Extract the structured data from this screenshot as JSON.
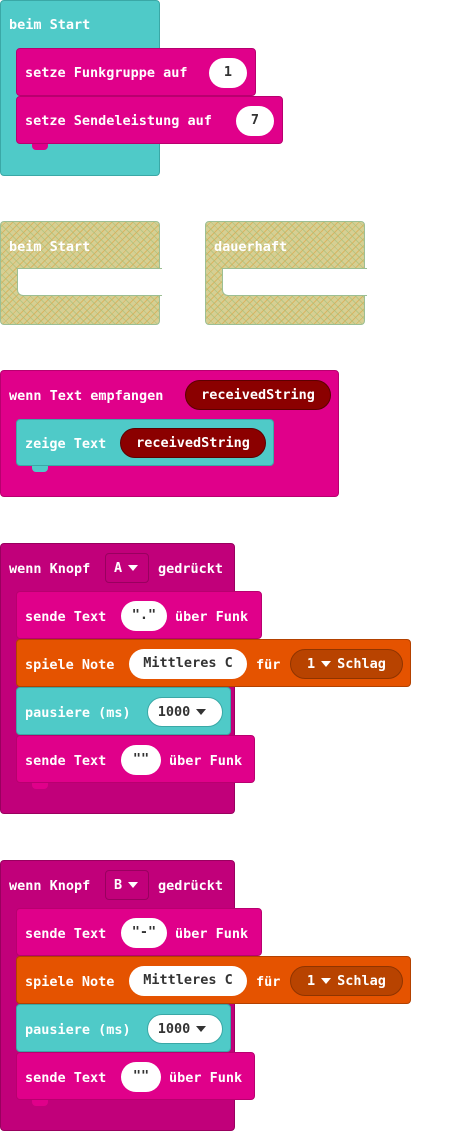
{
  "colors": {
    "basic": "#4fcac8",
    "radio": "#e0008a",
    "input": "#c1007a",
    "music": "#e55300",
    "text_var": "#8b0000"
  },
  "group1": {
    "hat": "beim Start",
    "set_group_label": "setze Funkgruppe auf",
    "set_group_value": "1",
    "set_power_label": "setze Sendeleistung auf",
    "set_power_value": "7"
  },
  "disabled": {
    "start_label": "beim Start",
    "forever_label": "dauerhaft"
  },
  "group2": {
    "hat_label": "wenn Text empfangen",
    "hat_var": "receivedString",
    "show_label": "zeige Text",
    "show_var": "receivedString"
  },
  "group3": {
    "hat_pre": "wenn Knopf",
    "button": "A",
    "hat_post": "gedrückt",
    "send1_pre": "sende Text",
    "send1_value": "\".\"",
    "send1_post": "über Funk",
    "note_pre": "spiele Note",
    "note_value": "Mittleres C",
    "note_mid": "für",
    "beat_value": "1",
    "beat_unit": "Schlag",
    "pause_label": "pausiere (ms)",
    "pause_value": "1000",
    "send2_pre": "sende Text",
    "send2_value": "\"\"",
    "send2_post": "über Funk"
  },
  "group4": {
    "hat_pre": "wenn Knopf",
    "button": "B",
    "hat_post": "gedrückt",
    "send1_pre": "sende Text",
    "send1_value": "\"-\"",
    "send1_post": "über Funk",
    "note_pre": "spiele Note",
    "note_value": "Mittleres C",
    "note_mid": "für",
    "beat_value": "1",
    "beat_unit": "Schlag",
    "pause_label": "pausiere (ms)",
    "pause_value": "1000",
    "send2_pre": "sende Text",
    "send2_value": "\"\"",
    "send2_post": "über Funk"
  }
}
